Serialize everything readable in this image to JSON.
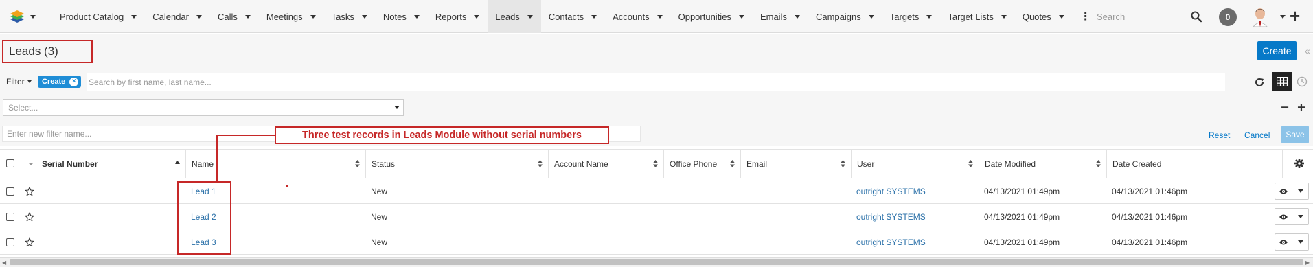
{
  "nav": {
    "tabs": [
      {
        "label": "Product Catalog",
        "has_dropdown": true
      },
      {
        "label": "Calendar",
        "has_dropdown": true
      },
      {
        "label": "Calls",
        "has_dropdown": true
      },
      {
        "label": "Meetings",
        "has_dropdown": true
      },
      {
        "label": "Tasks",
        "has_dropdown": true
      },
      {
        "label": "Notes",
        "has_dropdown": true
      },
      {
        "label": "Reports",
        "has_dropdown": true
      },
      {
        "label": "Leads",
        "has_dropdown": true,
        "active": true
      },
      {
        "label": "Contacts",
        "has_dropdown": true
      },
      {
        "label": "Accounts",
        "has_dropdown": true
      },
      {
        "label": "Opportunities",
        "has_dropdown": true
      },
      {
        "label": "Emails",
        "has_dropdown": true
      },
      {
        "label": "Campaigns",
        "has_dropdown": true
      },
      {
        "label": "Targets",
        "has_dropdown": true
      },
      {
        "label": "Target Lists",
        "has_dropdown": true
      },
      {
        "label": "Quotes",
        "has_dropdown": true
      }
    ],
    "more_icon": "vertical-ellipsis-icon",
    "search_placeholder": "Search",
    "notification_count": "0"
  },
  "header": {
    "title": "Leads (3)",
    "create_label": "Create"
  },
  "filter": {
    "dropdown_label": "Filter",
    "pill_label": "Create",
    "search_placeholder": "Search by first name, last name...",
    "select_placeholder": "Select...",
    "name_placeholder": "Enter new filter name...",
    "reset_label": "Reset",
    "cancel_label": "Cancel",
    "save_label": "Save"
  },
  "annotation": {
    "text": "Three test records in Leads Module without serial numbers"
  },
  "table": {
    "columns": [
      "Serial Number",
      "Name",
      "Status",
      "Account Name",
      "Office Phone",
      "Email",
      "User",
      "Date Modified",
      "Date Created"
    ],
    "rows": [
      {
        "serial": "",
        "name": "Lead 1",
        "status": "New",
        "account": "",
        "phone": "",
        "email": "",
        "user": "outright SYSTEMS",
        "modified": "04/13/2021 01:49pm",
        "created": "04/13/2021 01:46pm"
      },
      {
        "serial": "",
        "name": "Lead 2",
        "status": "New",
        "account": "",
        "phone": "",
        "email": "",
        "user": "outright SYSTEMS",
        "modified": "04/13/2021 01:49pm",
        "created": "04/13/2021 01:46pm"
      },
      {
        "serial": "",
        "name": "Lead 3",
        "status": "New",
        "account": "",
        "phone": "",
        "email": "",
        "user": "outright SYSTEMS",
        "modified": "04/13/2021 01:49pm",
        "created": "04/13/2021 01:46pm"
      }
    ]
  },
  "colors": {
    "accent": "#0679c8",
    "annotation_red": "#c62828",
    "link": "#2a70a8",
    "pill": "#1f8dd6"
  }
}
